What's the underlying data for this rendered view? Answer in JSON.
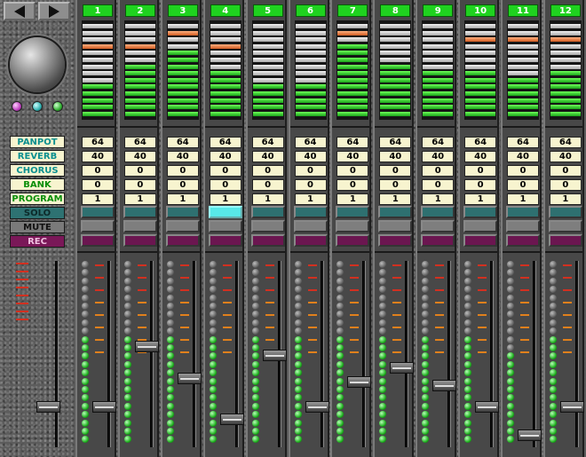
{
  "nav": {
    "prev_icon": "triangle-left",
    "next_icon": "triangle-right"
  },
  "master": {
    "knob_icon": "knob",
    "level": 0.18
  },
  "row_labels": {
    "panpot": "PANPOT",
    "reverb": "REVERB",
    "chorus": "CHORUS",
    "bank": "BANK",
    "program": "PROGRAM",
    "solo": "SOLO",
    "mute": "MUTE",
    "rec": "REC"
  },
  "colors": {
    "channel_number_bg": "#1fd21f",
    "meter_on": "#2fd02f",
    "meter_peak": "#e07030",
    "solo": "#2e7070",
    "rec": "#6b1650",
    "value_bg": "#f7f4cf"
  },
  "channels": [
    {
      "num": "1",
      "panpot": "64",
      "reverb": "40",
      "chorus": "0",
      "bank": "0",
      "program": "1",
      "meter": 0.37,
      "peak": 0.79,
      "fader": 0.18,
      "solo_lit": false
    },
    {
      "num": "2",
      "panpot": "64",
      "reverb": "40",
      "chorus": "0",
      "bank": "0",
      "program": "1",
      "meter": 0.6,
      "peak": 0.79,
      "fader": 0.52,
      "solo_lit": false
    },
    {
      "num": "3",
      "panpot": "64",
      "reverb": "40",
      "chorus": "0",
      "bank": "0",
      "program": "1",
      "meter": 0.7,
      "peak": 0.92,
      "fader": 0.34,
      "solo_lit": false
    },
    {
      "num": "4",
      "panpot": "64",
      "reverb": "40",
      "chorus": "0",
      "bank": "0",
      "program": "1",
      "meter": 0.52,
      "peak": 0.79,
      "fader": 0.11,
      "solo_lit": true
    },
    {
      "num": "5",
      "panpot": "64",
      "reverb": "40",
      "chorus": "0",
      "bank": "0",
      "program": "1",
      "meter": 0.37,
      "peak": null,
      "fader": 0.47,
      "solo_lit": false
    },
    {
      "num": "6",
      "panpot": "64",
      "reverb": "40",
      "chorus": "0",
      "bank": "0",
      "program": "1",
      "meter": 0.37,
      "peak": null,
      "fader": 0.18,
      "solo_lit": false
    },
    {
      "num": "7",
      "panpot": "64",
      "reverb": "40",
      "chorus": "0",
      "bank": "0",
      "program": "1",
      "meter": 0.78,
      "peak": 0.92,
      "fader": 0.32,
      "solo_lit": false
    },
    {
      "num": "8",
      "panpot": "64",
      "reverb": "40",
      "chorus": "0",
      "bank": "0",
      "program": "1",
      "meter": 0.6,
      "peak": null,
      "fader": 0.4,
      "solo_lit": false
    },
    {
      "num": "9",
      "panpot": "64",
      "reverb": "40",
      "chorus": "0",
      "bank": "0",
      "program": "1",
      "meter": 0.52,
      "peak": null,
      "fader": 0.3,
      "solo_lit": false
    },
    {
      "num": "10",
      "panpot": "64",
      "reverb": "40",
      "chorus": "0",
      "bank": "0",
      "program": "1",
      "meter": 0.52,
      "peak": 0.86,
      "fader": 0.18,
      "solo_lit": false
    },
    {
      "num": "11",
      "panpot": "64",
      "reverb": "40",
      "chorus": "0",
      "bank": "0",
      "program": "1",
      "meter": 0.44,
      "peak": 0.86,
      "fader": 0.02,
      "solo_lit": false
    },
    {
      "num": "12",
      "panpot": "64",
      "reverb": "40",
      "chorus": "0",
      "bank": "0",
      "program": "1",
      "meter": 0.52,
      "peak": 0.86,
      "fader": 0.18,
      "solo_lit": false
    }
  ]
}
